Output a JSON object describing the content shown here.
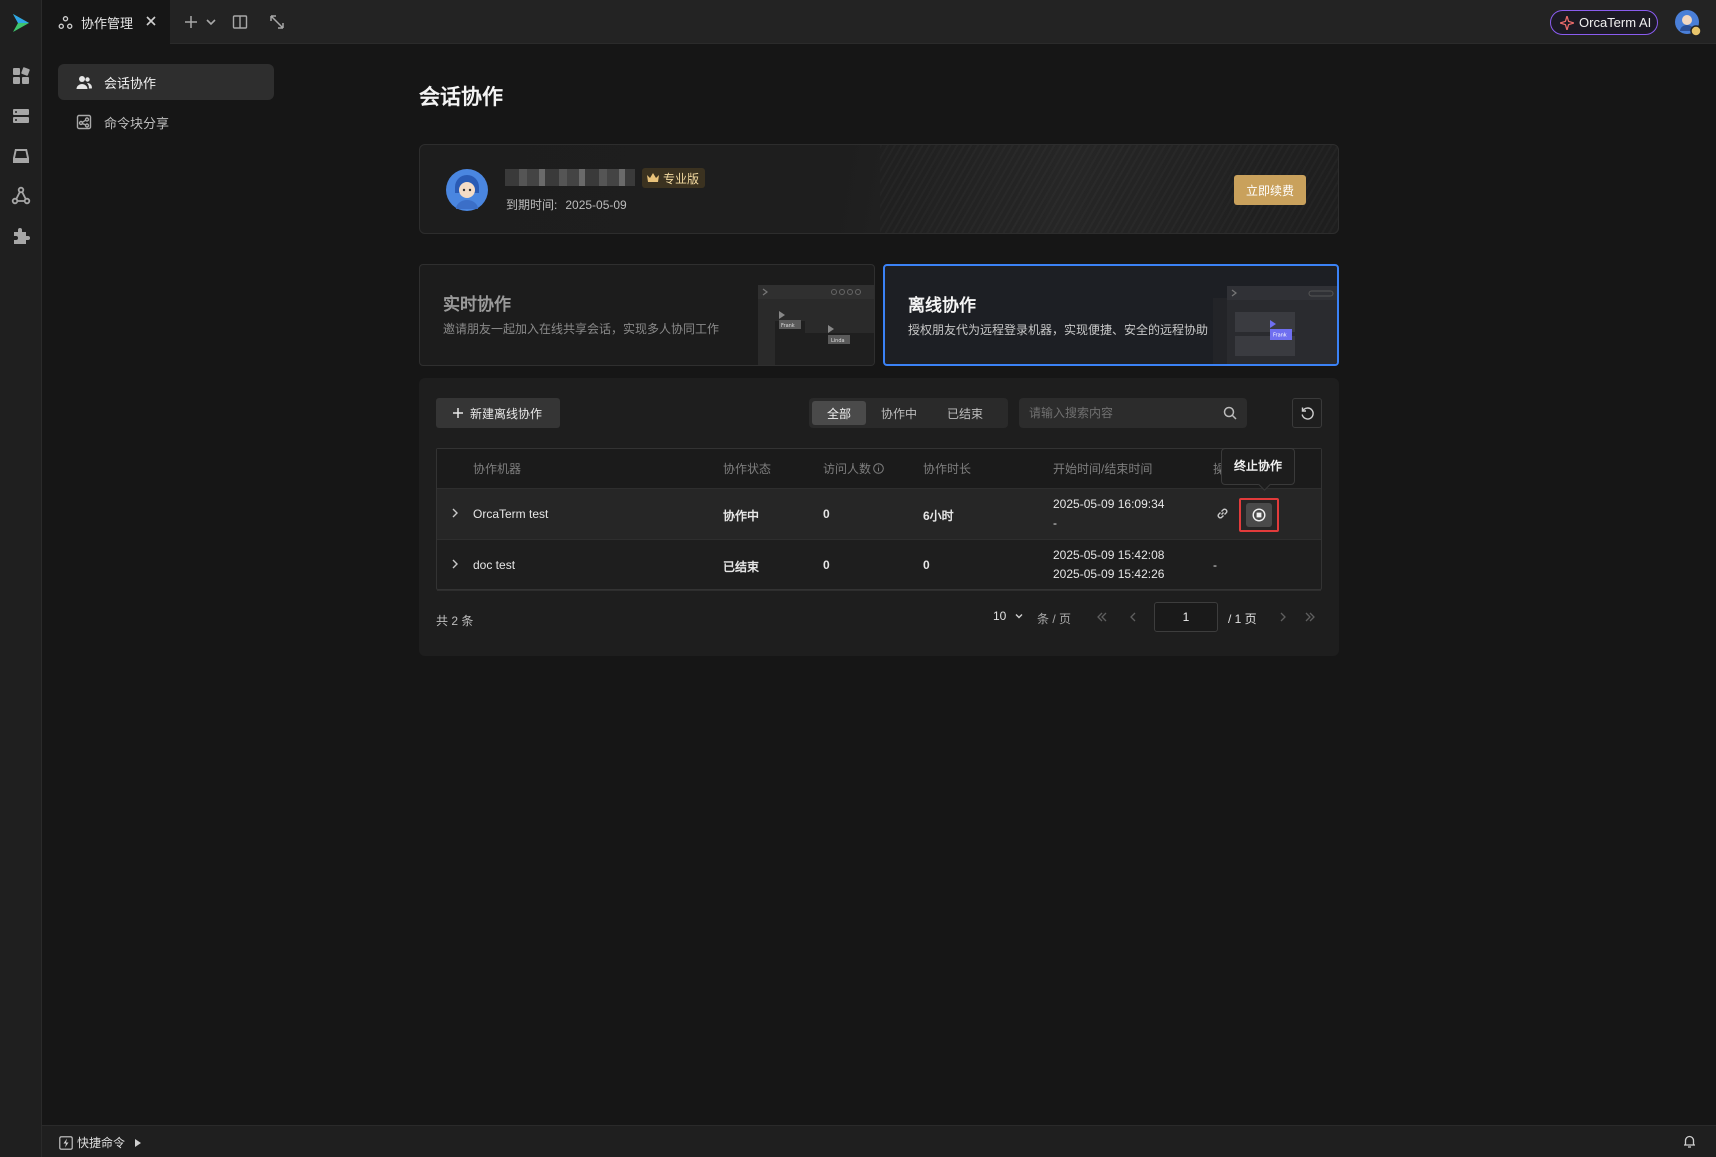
{
  "topbar": {
    "tab_label": "协作管理",
    "ai_button_label": "OrcaTerm AI"
  },
  "rail": {
    "icons": [
      "dashboard-icon",
      "server-icon",
      "storage-icon",
      "collaboration-icon",
      "plugin-icon"
    ]
  },
  "subnav": {
    "items": [
      {
        "label": "会话协作",
        "icon": "users-icon",
        "active": true
      },
      {
        "label": "命令块分享",
        "icon": "share-icon",
        "active": false
      }
    ]
  },
  "page": {
    "title": "会话协作"
  },
  "plan": {
    "badge": "专业版",
    "expiry_label": "到期时间:",
    "expiry_date": "2025-05-09",
    "renew_label": "立即续费"
  },
  "modes": [
    {
      "title": "实时协作",
      "desc": "邀请朋友一起加入在线共享会话，实现多人协同工作",
      "active": false,
      "tags": [
        "Frank",
        "Linda"
      ]
    },
    {
      "title": "离线协作",
      "desc": "授权朋友代为远程登录机器，实现便捷、安全的远程协助",
      "active": true,
      "tags": [
        "Frank"
      ]
    }
  ],
  "toolbar": {
    "new_label": "新建离线协作",
    "filters": [
      {
        "label": "全部",
        "active": true
      },
      {
        "label": "协作中",
        "active": false
      },
      {
        "label": "已结束",
        "active": false
      }
    ],
    "search_placeholder": "请输入搜索内容"
  },
  "table": {
    "columns": [
      "协作机器",
      "协作状态",
      "访问人数",
      "协作时长",
      "开始时间/结束时间",
      "操作"
    ],
    "rows": [
      {
        "machine": "OrcaTerm test",
        "status": "协作中",
        "visitors": "0",
        "duration": "6小时",
        "start": "2025-05-09 16:09:34",
        "end": "-",
        "ops": "actions"
      },
      {
        "machine": "doc test",
        "status": "已结束",
        "visitors": "0",
        "duration": "0",
        "start": "2025-05-09 15:42:08",
        "end": "2025-05-09 15:42:26",
        "ops": "-"
      }
    ],
    "tooltip": "终止协作"
  },
  "pagination": {
    "total_text": "共 2 条",
    "page_size": "10",
    "page_size_unit": "条 / 页",
    "current_page": "1",
    "total_pages": "/ 1 页"
  },
  "bottombar": {
    "quick_cmd_label": "快捷命令"
  },
  "colors": {
    "accent_blue": "#3b82f6",
    "gold": "#c9a15c",
    "highlight_red": "#e23b3b",
    "ai_purple": "#8a5cf0"
  }
}
